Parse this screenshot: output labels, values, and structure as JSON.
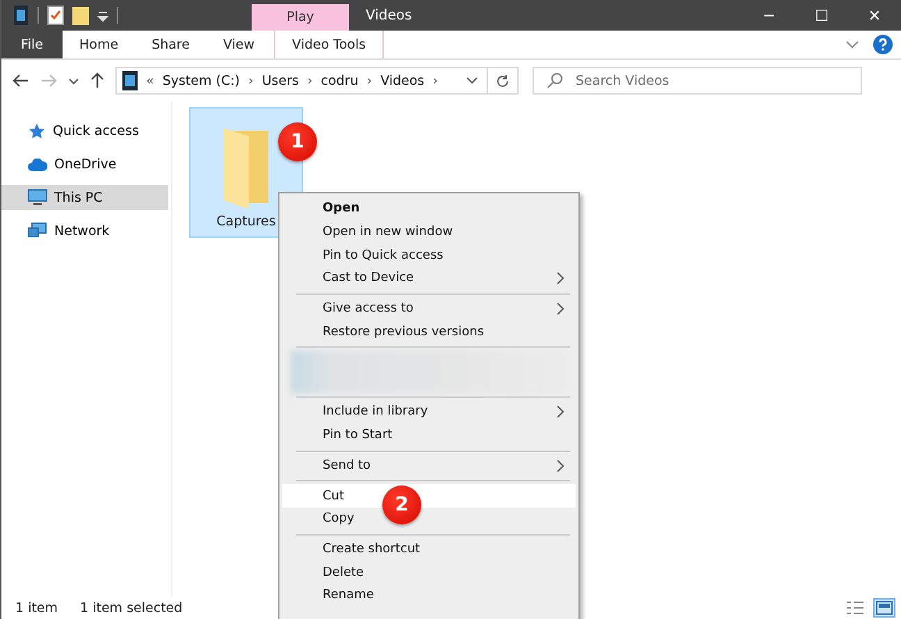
{
  "window": {
    "title": "Videos",
    "contextual_tab": "Play",
    "controls": [
      "─",
      "☐",
      "✕"
    ]
  },
  "ribbon": {
    "tabs": [
      {
        "label": "File",
        "selected": false,
        "kind": "file"
      },
      {
        "label": "Home",
        "selected": false,
        "kind": "tab"
      },
      {
        "label": "Share",
        "selected": false,
        "kind": "tab"
      },
      {
        "label": "View",
        "selected": false,
        "kind": "tab"
      },
      {
        "label": "Video Tools",
        "selected": false,
        "kind": "tab"
      }
    ]
  },
  "address": {
    "crumbs": [
      "«",
      "System (C:)",
      "›",
      "Users",
      "›",
      "codru",
      "›",
      "Videos",
      "›"
    ]
  },
  "search": {
    "placeholder": "Search Videos"
  },
  "sidebar": {
    "items": [
      {
        "label": "Quick access",
        "selected": false,
        "kind": "star"
      },
      {
        "label": "OneDrive",
        "selected": false,
        "kind": "cloud"
      },
      {
        "label": "This PC",
        "selected": true,
        "kind": "pc"
      },
      {
        "label": "Network",
        "selected": false,
        "kind": "network"
      }
    ]
  },
  "files": [
    {
      "name": "Captures",
      "selected": true
    }
  ],
  "context_menu": {
    "items": [
      {
        "kind": "item",
        "label": "Open",
        "default": true,
        "submenu": false,
        "selected": false
      },
      {
        "kind": "item",
        "label": "Open in new window",
        "default": false,
        "submenu": false,
        "selected": false
      },
      {
        "kind": "item",
        "label": "Pin to Quick access",
        "default": false,
        "submenu": false,
        "selected": false
      },
      {
        "kind": "item",
        "label": "Cast to Device",
        "default": false,
        "submenu": true,
        "selected": false
      },
      {
        "kind": "separator"
      },
      {
        "kind": "item",
        "label": "Give access to",
        "default": false,
        "submenu": true,
        "selected": false
      },
      {
        "kind": "item",
        "label": "Restore previous versions",
        "default": false,
        "submenu": false,
        "selected": false
      },
      {
        "kind": "separator"
      },
      {
        "kind": "blurred"
      },
      {
        "kind": "separator"
      },
      {
        "kind": "item",
        "label": "Include in library",
        "default": false,
        "submenu": true,
        "selected": false
      },
      {
        "kind": "item",
        "label": "Pin to Start",
        "default": false,
        "submenu": false,
        "selected": false
      },
      {
        "kind": "separator"
      },
      {
        "kind": "item",
        "label": "Send to",
        "default": false,
        "submenu": true,
        "selected": false
      },
      {
        "kind": "separator"
      },
      {
        "kind": "item",
        "label": "Cut",
        "default": false,
        "submenu": false,
        "selected": true
      },
      {
        "kind": "item",
        "label": "Copy",
        "default": false,
        "submenu": false,
        "selected": false
      },
      {
        "kind": "separator"
      },
      {
        "kind": "item",
        "label": "Create shortcut",
        "default": false,
        "submenu": false,
        "selected": false
      },
      {
        "kind": "item",
        "label": "Delete",
        "default": false,
        "submenu": false,
        "selected": false
      },
      {
        "kind": "item",
        "label": "Rename",
        "default": false,
        "submenu": false,
        "selected": false
      }
    ]
  },
  "callouts": [
    "1",
    "2"
  ],
  "status_bar": {
    "count": "1 item",
    "selection": "1 item selected"
  }
}
